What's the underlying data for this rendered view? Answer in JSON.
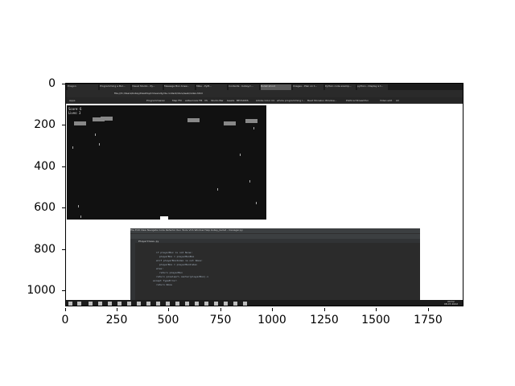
{
  "axis": {
    "x_ticks": [
      "0",
      "250",
      "500",
      "750",
      "1000",
      "1250",
      "1500",
      "1750"
    ],
    "y_ticks": [
      "0",
      "200",
      "400",
      "600",
      "800",
      "1000"
    ]
  },
  "browser": {
    "tabs": [
      "Eragon",
      "Programming a Bul...",
      "Visual Studio - Py...",
      "Message Box Answ...",
      "Mike - PyM...",
      "Contents · bobsy/c...",
      "Bullet shoot",
      "Images - Plan on t...",
      "Python code examp...",
      "python - Display a t..."
    ],
    "url": "file:///C:/Users/bobsy/Desktop/University/ds-content/docs/web/index.html",
    "bookmarks": [
      "Apps",
      "Programmieren",
      "Map FM",
      "eAtavcosis FM",
      "VS",
      "Studio Bar",
      "Geeks",
      "BEYAKIDS",
      "Adobe Color CC",
      "whole programming l...",
      "Beat Stoneluv Window...",
      "Political Streamfun",
      "Video edit",
      "All"
    ]
  },
  "game": {
    "score": "Score: 6",
    "lives": "Lives: 3"
  },
  "ide": {
    "menu": "File  Edit  View  Navigate  Code  Refactor  Run  Tools  VCS  Window  Help    bobsy_bullet - manager.py",
    "tab": "PlayerClass.py",
    "code_lines": [
      "if playerBox is not None:",
      "    playerBox = playerBoxBox",
      "elif playerBoxIndex is not None:",
      "    playerBox = playerBoxIndex",
      "else:",
      "    return playerBox",
      "return pixelsprl.center(playerBox).x",
      "except TypeError:",
      "    return None"
    ]
  },
  "taskbar": {
    "time": "09:52",
    "date": "08.07.2022"
  }
}
